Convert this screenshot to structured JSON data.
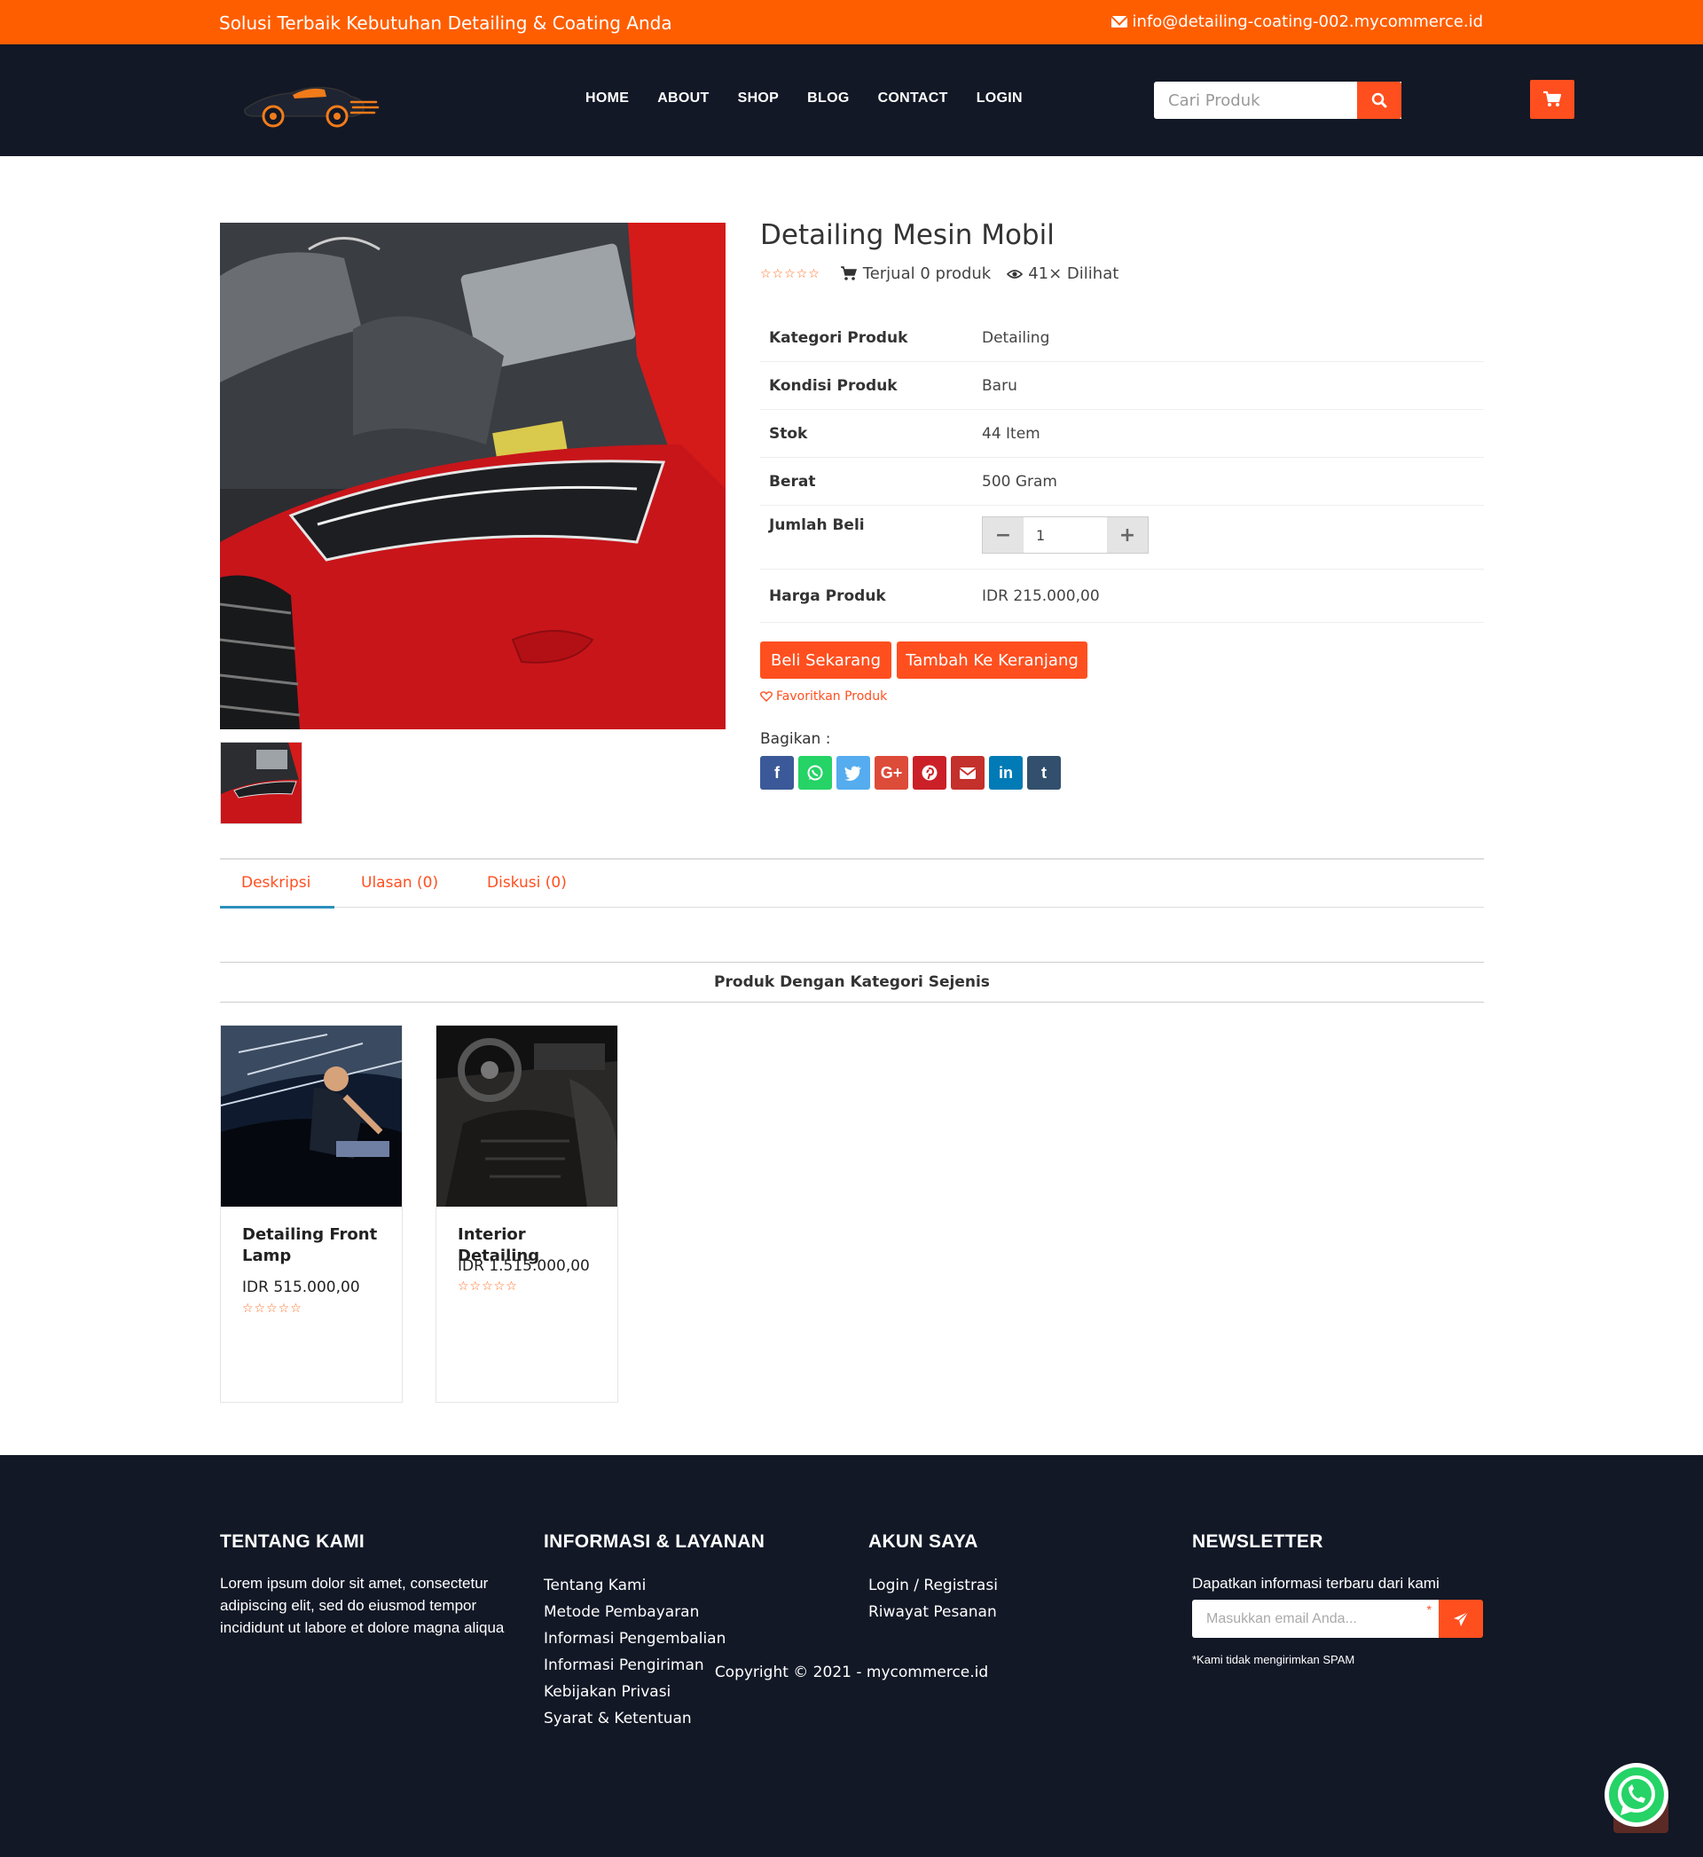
{
  "topbar": {
    "tagline": "Solusi Terbaik Kebutuhan Detailing & Coating Anda",
    "email": "info@detailing-coating-002.mycommerce.id"
  },
  "nav": {
    "items": [
      "HOME",
      "ABOUT",
      "SHOP",
      "BLOG",
      "CONTACT",
      "LOGIN"
    ],
    "search_placeholder": "Cari Produk"
  },
  "product": {
    "title": "Detailing Mesin Mobil",
    "rating_stars": "☆☆☆☆☆",
    "sold": "Terjual 0 produk",
    "views": "41× Dilihat",
    "specs": [
      {
        "label": "Kategori Produk",
        "value": "Detailing"
      },
      {
        "label": "Kondisi Produk",
        "value": "Baru"
      },
      {
        "label": "Stok",
        "value": "44 Item"
      },
      {
        "label": "Berat",
        "value": "500 Gram"
      }
    ],
    "qty_label": "Jumlah Beli",
    "qty_value": "1",
    "price_label": "Harga Produk",
    "price": "IDR 215.000,00",
    "buy_label": "Beli Sekarang",
    "cart_label": "Tambah Ke Keranjang",
    "fav_label": "Favoritkan Produk",
    "share_label": "Bagikan :"
  },
  "share_buttons": [
    {
      "name": "facebook",
      "glyph": "f",
      "color": "#3b5998"
    },
    {
      "name": "whatsapp",
      "glyph": "✆",
      "color": "#25d366"
    },
    {
      "name": "twitter",
      "glyph": "t",
      "color": "#55acee"
    },
    {
      "name": "google-plus",
      "glyph": "G+",
      "color": "#dd4b39"
    },
    {
      "name": "pinterest",
      "glyph": "P",
      "color": "#cb2027"
    },
    {
      "name": "email",
      "glyph": "✉",
      "color": "#c4302b"
    },
    {
      "name": "linkedin",
      "glyph": "in",
      "color": "#007bb6"
    },
    {
      "name": "tumblr",
      "glyph": "t",
      "color": "#32506d"
    }
  ],
  "tabs": [
    "Deskripsi",
    "Ulasan (0)",
    "Diskusi (0)"
  ],
  "related": {
    "title": "Produk Dengan Kategori Sejenis",
    "items": [
      {
        "name": "Detailing Front Lamp",
        "price": "IDR 515.000,00",
        "stars": "☆☆☆☆☆"
      },
      {
        "name": "Interior Detailing",
        "price": "IDR 1.515.000,00",
        "stars": "☆☆☆☆☆"
      }
    ]
  },
  "footer": {
    "about_title": "TENTANG KAMI",
    "about_text": "Lorem ipsum dolor sit amet, consectetur adipiscing elit, sed do eiusmod tempor incididunt ut labore et dolore magna aliqua",
    "info_title": "INFORMASI & LAYANAN",
    "info_links": [
      "Tentang Kami",
      "Metode Pembayaran",
      "Informasi Pengembalian",
      "Informasi Pengiriman",
      "Kebijakan Privasi",
      "Syarat & Ketentuan"
    ],
    "account_title": "AKUN SAYA",
    "account_links": [
      "Login / Registrasi",
      "Riwayat Pesanan"
    ],
    "newsletter_title": "NEWSLETTER",
    "newsletter_text": "Dapatkan informasi terbaru dari kami",
    "newsletter_placeholder": "Masukkan email Anda...",
    "newsletter_note": "*Kami tidak mengirimkan SPAM",
    "copyright": "Copyright © 2021 - mycommerce.id"
  },
  "colors": {
    "accent": "#ff4f1f",
    "topbar": "#ff5e00",
    "dark": "#121826"
  }
}
